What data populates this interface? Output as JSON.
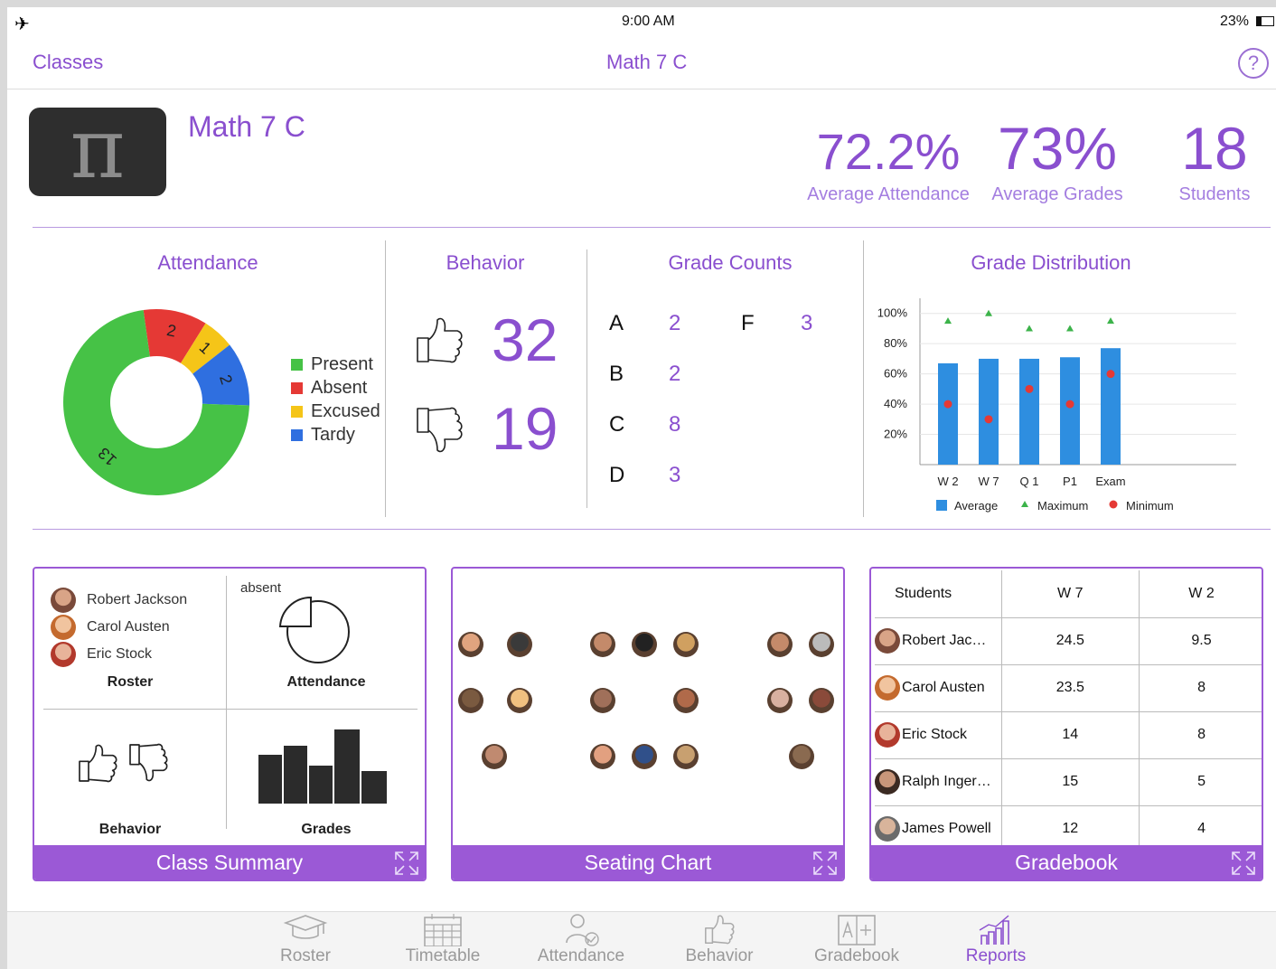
{
  "status_bar": {
    "time": "9:00 AM",
    "battery": "23%"
  },
  "nav": {
    "back_label": "Classes",
    "title": "Math 7 C",
    "help": "?"
  },
  "class_header": {
    "name": "Math 7 C",
    "icon_glyph": "π",
    "stats": [
      {
        "value": "72.2%",
        "label": "Average Attendance"
      },
      {
        "value": "73%",
        "label": "Average Grades"
      },
      {
        "value": "18",
        "label": "Students"
      }
    ]
  },
  "attendance": {
    "title": "Attendance",
    "slices": [
      {
        "label": "Present",
        "value": 13,
        "color": "#46c246"
      },
      {
        "label": "Absent",
        "value": 2,
        "color": "#e53935"
      },
      {
        "label": "Excused",
        "value": 1,
        "color": "#f5c518"
      },
      {
        "label": "Tardy",
        "value": 2,
        "color": "#2f6fe0"
      }
    ]
  },
  "behavior": {
    "title": "Behavior",
    "positive": "32",
    "negative": "19"
  },
  "grade_counts": {
    "title": "Grade Counts",
    "items": [
      {
        "grade": "A",
        "count": "2"
      },
      {
        "grade": "B",
        "count": "2"
      },
      {
        "grade": "C",
        "count": "8"
      },
      {
        "grade": "D",
        "count": "3"
      },
      {
        "grade": "F",
        "count": "3"
      }
    ]
  },
  "chart_data": {
    "type": "bar",
    "title": "Grade Distribution",
    "categories": [
      "W 2",
      "W 7",
      "Q 1",
      "P1",
      "Exam"
    ],
    "yticks": [
      "20%",
      "40%",
      "60%",
      "80%",
      "100%"
    ],
    "ylim": [
      0,
      110
    ],
    "series": [
      {
        "name": "Average",
        "values": [
          67,
          70,
          70,
          71,
          77
        ],
        "color": "#2e8ee0"
      },
      {
        "name": "Maximum",
        "values": [
          95,
          100,
          90,
          90,
          95
        ],
        "color": "#3cb34a"
      },
      {
        "name": "Minimum",
        "values": [
          40,
          30,
          50,
          40,
          60
        ],
        "color": "#e53935"
      }
    ]
  },
  "cards": {
    "class_summary": {
      "title": "Class Summary",
      "roster_names": [
        "Robert Jackson",
        "Carol Austen",
        "Eric Stock"
      ],
      "roster_label": "Roster",
      "absent_label": "absent",
      "attendance_label": "Attendance",
      "behavior_label": "Behavior",
      "grades_label": "Grades"
    },
    "seating_chart": {
      "title": "Seating Chart"
    },
    "gradebook": {
      "title": "Gradebook",
      "headers": [
        "Students",
        "W 7",
        "W 2"
      ],
      "rows": [
        {
          "name": "Robert Jac…",
          "w7": "24.5",
          "w2": "9.5"
        },
        {
          "name": "Carol Austen",
          "w7": "23.5",
          "w2": "8"
        },
        {
          "name": "Eric Stock",
          "w7": "14",
          "w2": "8"
        },
        {
          "name": "Ralph Inger…",
          "w7": "15",
          "w2": "5"
        },
        {
          "name": "James Powell",
          "w7": "12",
          "w2": "4"
        }
      ]
    }
  },
  "tabbar": {
    "tabs": [
      {
        "label": "Roster",
        "icon": "graduation-cap-icon"
      },
      {
        "label": "Timetable",
        "icon": "calendar-icon"
      },
      {
        "label": "Attendance",
        "icon": "attendance-icon"
      },
      {
        "label": "Behavior",
        "icon": "thumbs-up-icon"
      },
      {
        "label": "Gradebook",
        "icon": "gradebook-icon"
      },
      {
        "label": "Reports",
        "icon": "reports-icon"
      }
    ],
    "active": "Reports"
  }
}
